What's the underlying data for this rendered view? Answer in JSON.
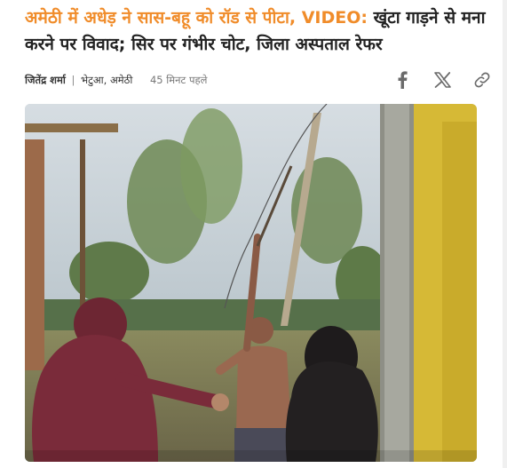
{
  "article": {
    "headline_highlight": "अमेठी में अधेड़ ने सास-बहू को रॉड से पीटा, VIDEO:",
    "headline_rest": " खूंटा गाड़ने से मना करने पर विवाद; सिर पर गंभीर चोट, जिला अस्पताल रेफर",
    "author": "जितेंद्र शर्मा",
    "location": "भेटुआ, अमेठी",
    "separator": "|",
    "time_ago": "45 मिनट पहले"
  },
  "share": {
    "icons": [
      "facebook-icon",
      "x-icon",
      "link-icon"
    ]
  },
  "colors": {
    "headline_accent": "#f08c2a",
    "headline_text": "#222222",
    "icon_gray": "#6b6b6b"
  },
  "media": {
    "type": "video-thumbnail"
  }
}
